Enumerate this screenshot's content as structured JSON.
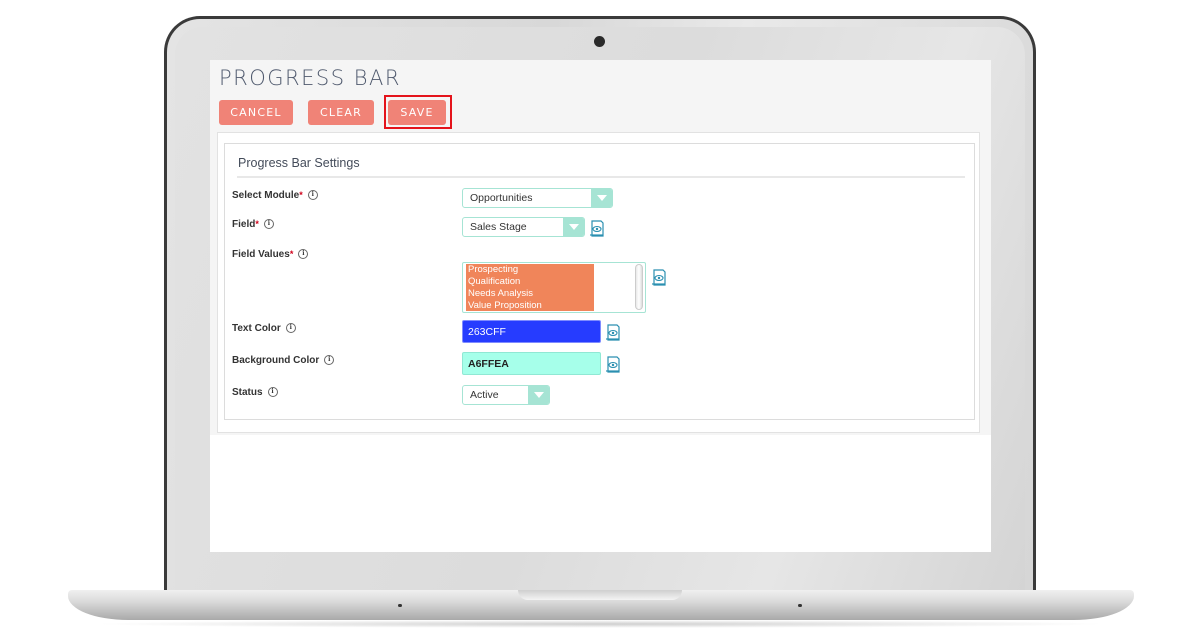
{
  "page": {
    "title": "PROGRESS BAR"
  },
  "toolbar": {
    "cancel_label": "CANCEL",
    "clear_label": "CLEAR",
    "save_label": "SAVE",
    "highlighted_button": "save"
  },
  "settings": {
    "section_title": "Progress Bar Settings",
    "fields": {
      "module": {
        "label": "Select Module",
        "required": "*",
        "value": "Opportunities"
      },
      "field": {
        "label": "Field",
        "required": "*",
        "value": "Sales Stage"
      },
      "field_values": {
        "label": "Field Values",
        "required": "*",
        "options": [
          "Prospecting",
          "Qualification",
          "Needs Analysis",
          "Value Proposition"
        ],
        "selected": [
          "Prospecting",
          "Qualification",
          "Needs Analysis",
          "Value Proposition"
        ]
      },
      "text_color": {
        "label": "Text Color",
        "value": "263CFF"
      },
      "background_color": {
        "label": "Background Color",
        "value": "A6FFEA"
      },
      "status": {
        "label": "Status",
        "value": "Active"
      }
    },
    "info_glyph": "i"
  },
  "colors": {
    "button": "#f08377",
    "highlight_border": "#e4131b",
    "select_accent": "#a6e4d4",
    "selected_option_bg": "#f0855a",
    "text_color_swatch": "#263CFF",
    "background_color_swatch": "#A6FFEA"
  }
}
